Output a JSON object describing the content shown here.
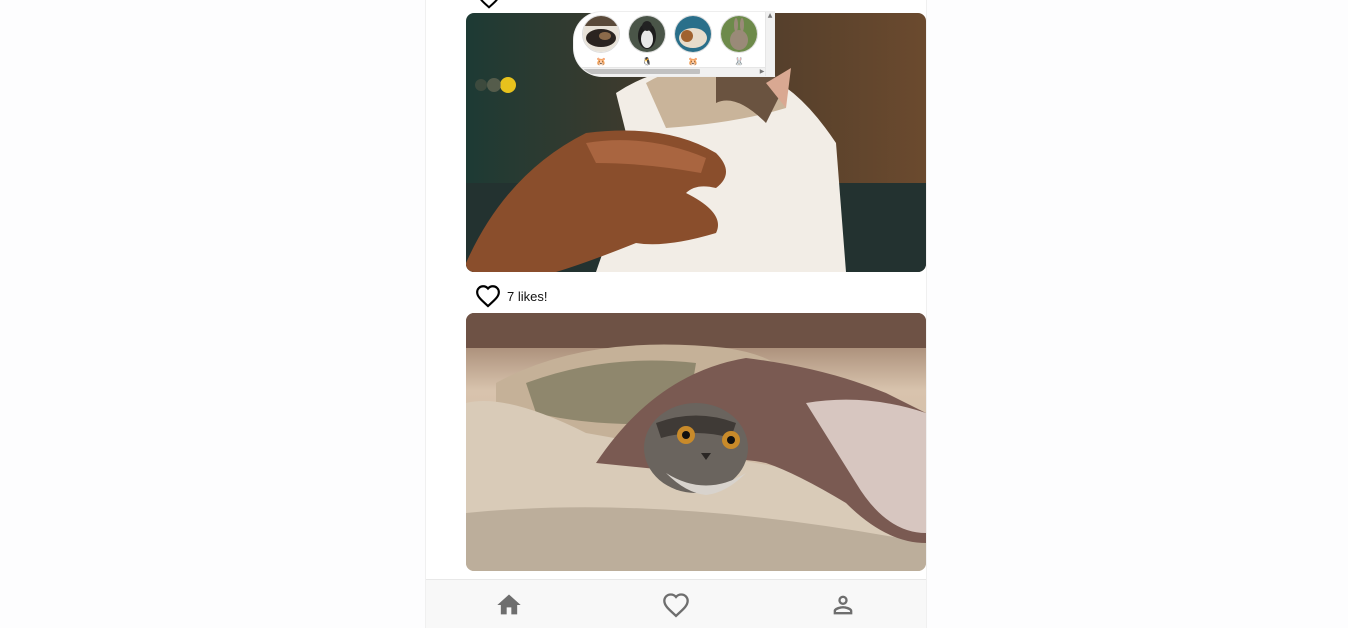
{
  "feed": {
    "posts": [
      {
        "photo_icon": "cat-being-petted-photo"
      },
      {
        "photo_icon": "cat-under-blanket-photo",
        "likes_text": "7 likes!",
        "like_icon": "heart-outline-icon"
      }
    ]
  },
  "stories": {
    "items": [
      {
        "avatar": "hamster-avatar",
        "emoji": "🐹"
      },
      {
        "avatar": "penguin-avatar",
        "emoji": "🐧"
      },
      {
        "avatar": "guinea-pig-avatar",
        "emoji": "🐹"
      },
      {
        "avatar": "rabbit-avatar",
        "emoji": "🐰"
      }
    ]
  },
  "bottom_nav": {
    "items": [
      {
        "icon": "home-icon"
      },
      {
        "icon": "heart-outline-icon"
      },
      {
        "icon": "person-icon"
      }
    ]
  },
  "colors": {
    "icon_gray": "#6e6e6e",
    "heart_black": "#000000",
    "nav_bg": "#f8f8f8"
  }
}
